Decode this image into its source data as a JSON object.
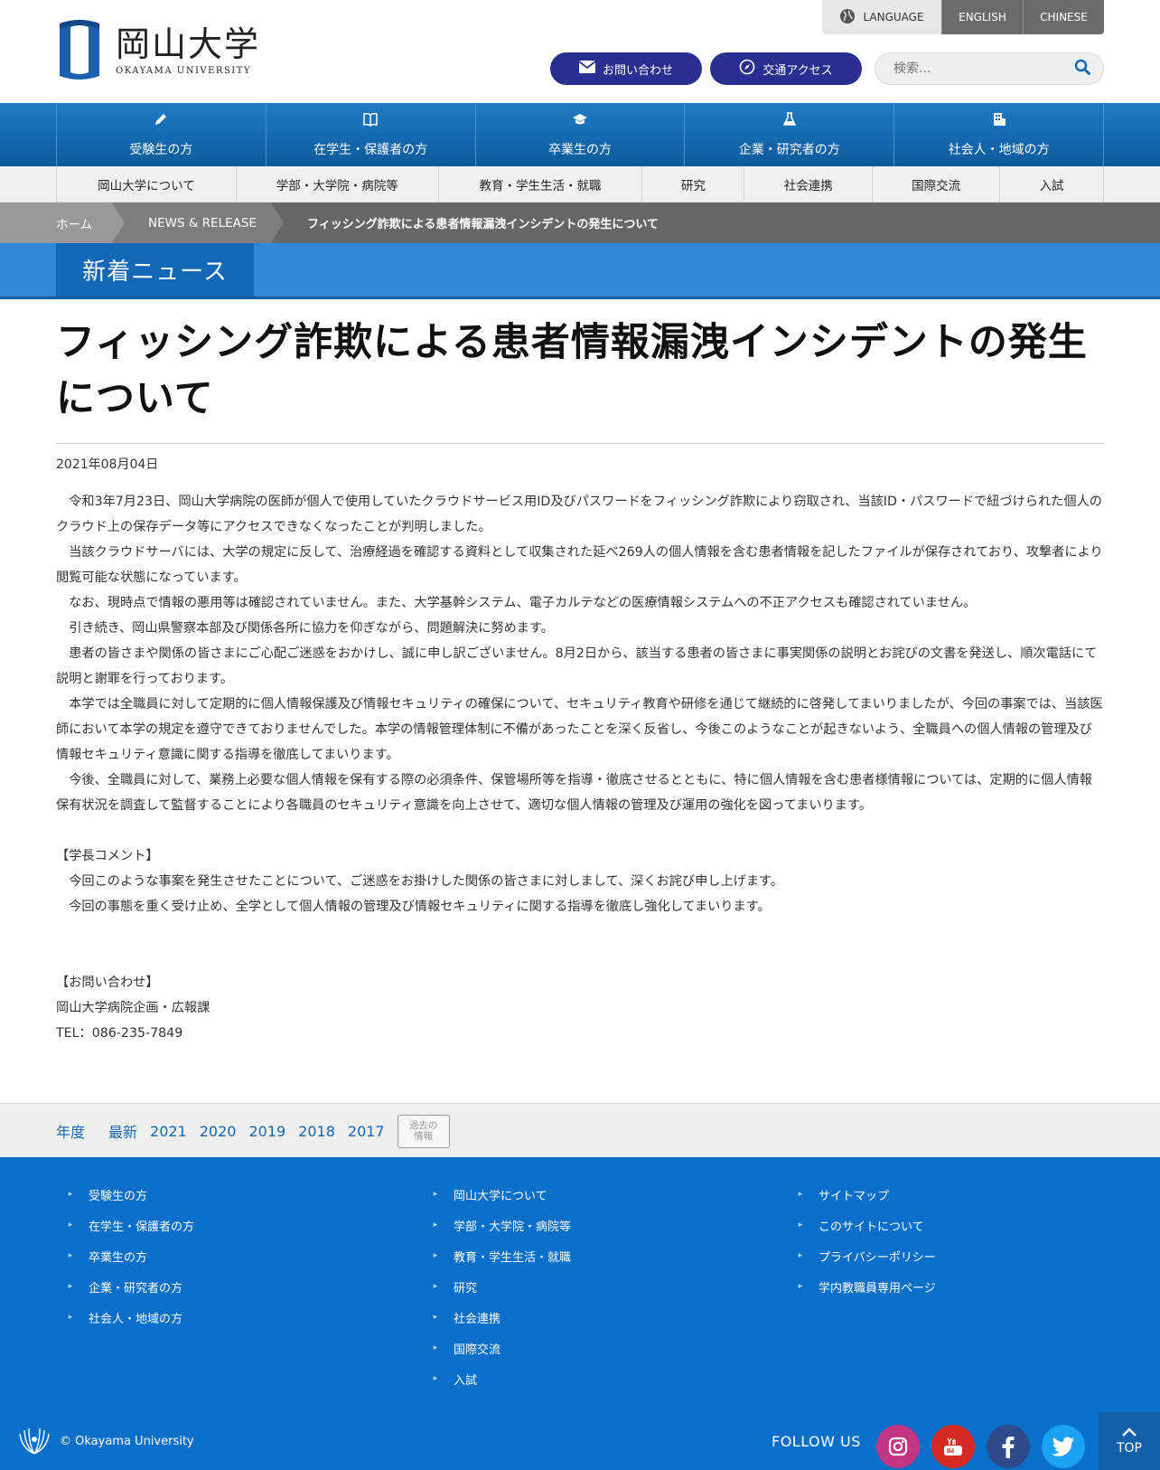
{
  "header": {
    "logo_jp": "岡山大学",
    "logo_en": "OKAYAMA UNIVERSITY",
    "language_label": "LANGUAGE",
    "languages": [
      "ENGLISH",
      "CHINESE"
    ],
    "contact_label": "お問い合わせ",
    "access_label": "交通アクセス",
    "search_placeholder": "検索..."
  },
  "gnav": [
    {
      "label": "受験生の方",
      "icon": "pencil-icon"
    },
    {
      "label": "在学生・保護者の方",
      "icon": "book-icon"
    },
    {
      "label": "卒業生の方",
      "icon": "graduation-cap-icon"
    },
    {
      "label": "企業・研究者の方",
      "icon": "flask-icon"
    },
    {
      "label": "社会人・地域の方",
      "icon": "building-icon"
    }
  ],
  "snav": [
    "岡山大学について",
    "学部・大学院・病院等",
    "教育・学生生活・就職",
    "研究",
    "社会連携",
    "国際交流",
    "入試"
  ],
  "breadcrumb": {
    "home": "ホーム",
    "section": "NEWS & RELEASE",
    "current": "フィッシング詐欺による患者情報漏洩インシデントの発生について"
  },
  "section_title": "新着ニュース",
  "article": {
    "title": "フィッシング詐欺による患者情報漏洩インシデントの発生について",
    "date": "2021年08月04日",
    "paragraphs": [
      "令和3年7月23日、岡山大学病院の医師が個人で使用していたクラウドサービス用ID及びパスワードをフィッシング詐欺により窃取され、当該ID・パスワードで紐づけられた個人のクラウド上の保存データ等にアクセスできなくなったことが判明しました。",
      "当該クラウドサーバには、大学の規定に反して、治療経過を確認する資料として収集された延べ269人の個人情報を含む患者情報を記したファイルが保存されており、攻撃者により閲覧可能な状態になっています。",
      "なお、現時点で情報の悪用等は確認されていません。また、大学基幹システム、電子カルテなどの医療情報システムへの不正アクセスも確認されていません。",
      "引き続き、岡山県警察本部及び関係各所に協力を仰ぎながら、問題解決に努めます。",
      "患者の皆さまや関係の皆さまにご心配ご迷惑をおかけし、誠に申し訳ございません。8月2日から、該当する患者の皆さまに事実関係の説明とお詫びの文書を発送し、順次電話にて説明と謝罪を行っております。",
      "本学では全職員に対して定期的に個人情報保護及び情報セキュリティの確保について、セキュリティ教育や研修を通じて継続的に啓発してまいりましたが、今回の事案では、当該医師において本学の規定を遵守できておりませんでした。本学の情報管理体制に不備があったことを深く反省し、今後このようなことが起きないよう、全職員への個人情報の管理及び情報セキュリティ意識に関する指導を徹底してまいります。",
      "今後、全職員に対して、業務上必要な個人情報を保有する際の必須条件、保管場所等を指導・徹底させるとともに、特に個人情報を含む患者様情報については、定期的に個人情報保有状況を調査して監督することにより各職員のセキュリティ意識を向上させて、適切な個人情報の管理及び運用の強化を図ってまいります。"
    ],
    "president_heading": "【学長コメント】",
    "president_comments": [
      "今回このような事案を発生させたことについて、ご迷惑をお掛けした関係の皆さまに対しまして、深くお詫び申し上げます。",
      "今回の事態を重く受け止め、全学として個人情報の管理及び情報セキュリティに関する指導を徹底し強化してまいります。"
    ],
    "contact_heading": "【お問い合わせ】",
    "contact_org": "岡山大学病院企画・広報課",
    "contact_tel": "TEL：086-235-7849"
  },
  "yearbar": {
    "label": "年度",
    "years": [
      "最新",
      "2021",
      "2020",
      "2019",
      "2018",
      "2017"
    ],
    "past_line1": "過去の",
    "past_line2": "情報"
  },
  "footer": {
    "col1": [
      "受験生の方",
      "在学生・保護者の方",
      "卒業生の方",
      "企業・研究者の方",
      "社会人・地域の方"
    ],
    "col2": [
      "岡山大学について",
      "学部・大学院・病院等",
      "教育・学生生活・就職",
      "研究",
      "社会連携",
      "国際交流",
      "入試"
    ],
    "col3": [
      "サイトマップ",
      "このサイトについて",
      "プライバシーポリシー",
      "学内教職員専用ページ"
    ],
    "copyright": "© Okayama University",
    "follow_us": "FOLLOW US",
    "totop": "TOP"
  }
}
